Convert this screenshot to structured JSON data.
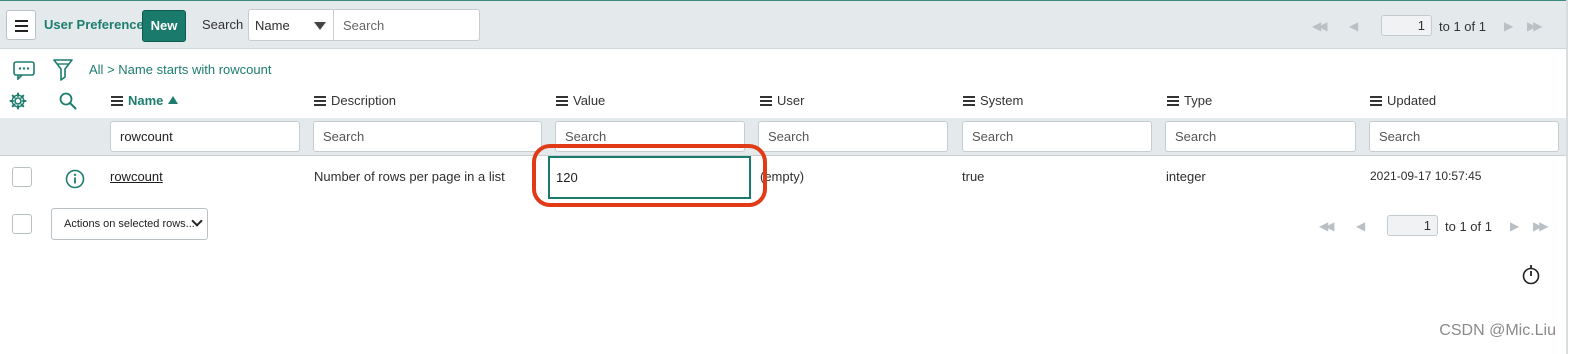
{
  "header": {
    "app_title": "User Preferences",
    "new_label": "New",
    "search_label": "Search",
    "search_field": "Name",
    "search_placeholder": "Search",
    "pager": {
      "first": "◀◀",
      "prev": "◀",
      "page": "1",
      "of_text": "to 1 of 1",
      "next": "▶",
      "last": "▶▶"
    }
  },
  "breadcrumb": {
    "all": "All",
    "sep": ">",
    "filter": "Name starts with rowcount"
  },
  "columns": [
    {
      "label": "Name",
      "sorted": "ascending"
    },
    {
      "label": "Description"
    },
    {
      "label": "Value"
    },
    {
      "label": "User"
    },
    {
      "label": "System"
    },
    {
      "label": "Type"
    },
    {
      "label": "Updated"
    }
  ],
  "filters": {
    "name_value": "rowcount",
    "placeholder": "Search"
  },
  "rows": [
    {
      "name": "rowcount",
      "description": "Number of rows per page in a list",
      "value": "120",
      "user": "(empty)",
      "system": "true",
      "type": "integer",
      "updated": "2021-09-17 10:57:45"
    }
  ],
  "footer": {
    "actions_label": "Actions on selected rows...",
    "pager": {
      "page": "1",
      "of_text": "to 1 of 1"
    }
  },
  "watermark": "CSDN @Mic.Liu",
  "colors": {
    "accent": "#1a7a6c",
    "header_bg": "#e4e9ec",
    "highlight": "#e03a17"
  }
}
